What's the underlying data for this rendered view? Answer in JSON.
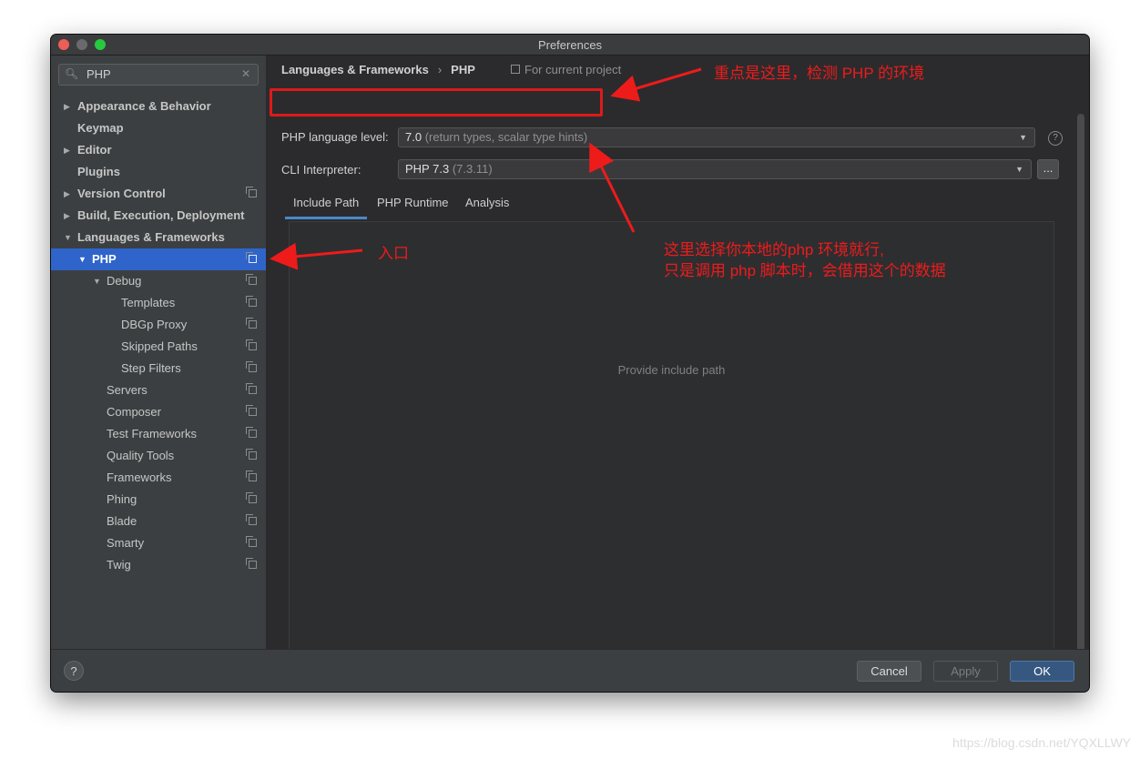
{
  "window": {
    "title": "Preferences"
  },
  "search": {
    "value": "PHP",
    "icon": "search-icon"
  },
  "sidebar": {
    "items": [
      {
        "label": "Appearance & Behavior",
        "arrow": "▶",
        "level": 0,
        "bold": true,
        "copy": false
      },
      {
        "label": "Keymap",
        "arrow": "",
        "level": 0,
        "bold": true,
        "copy": false
      },
      {
        "label": "Editor",
        "arrow": "▶",
        "level": 0,
        "bold": true,
        "copy": false
      },
      {
        "label": "Plugins",
        "arrow": "",
        "level": 0,
        "bold": true,
        "copy": false
      },
      {
        "label": "Version Control",
        "arrow": "▶",
        "level": 0,
        "bold": true,
        "copy": true
      },
      {
        "label": "Build, Execution, Deployment",
        "arrow": "▶",
        "level": 0,
        "bold": true,
        "copy": false
      },
      {
        "label": "Languages & Frameworks",
        "arrow": "▼",
        "level": 0,
        "bold": true,
        "copy": false
      },
      {
        "label": "PHP",
        "arrow": "▼",
        "level": 1,
        "bold": true,
        "copy": true,
        "selected": true
      },
      {
        "label": "Debug",
        "arrow": "▼",
        "level": 2,
        "bold": false,
        "copy": true
      },
      {
        "label": "Templates",
        "arrow": "",
        "level": 3,
        "bold": false,
        "copy": true
      },
      {
        "label": "DBGp Proxy",
        "arrow": "",
        "level": 3,
        "bold": false,
        "copy": true
      },
      {
        "label": "Skipped Paths",
        "arrow": "",
        "level": 3,
        "bold": false,
        "copy": true
      },
      {
        "label": "Step Filters",
        "arrow": "",
        "level": 3,
        "bold": false,
        "copy": true
      },
      {
        "label": "Servers",
        "arrow": "",
        "level": 2,
        "bold": false,
        "copy": true
      },
      {
        "label": "Composer",
        "arrow": "",
        "level": 2,
        "bold": false,
        "copy": true
      },
      {
        "label": "Test Frameworks",
        "arrow": "",
        "level": 2,
        "bold": false,
        "copy": true
      },
      {
        "label": "Quality Tools",
        "arrow": "",
        "level": 2,
        "bold": false,
        "copy": true
      },
      {
        "label": "Frameworks",
        "arrow": "",
        "level": 2,
        "bold": false,
        "copy": true
      },
      {
        "label": "Phing",
        "arrow": "",
        "level": 2,
        "bold": false,
        "copy": true
      },
      {
        "label": "Blade",
        "arrow": "",
        "level": 2,
        "bold": false,
        "copy": true
      },
      {
        "label": "Smarty",
        "arrow": "",
        "level": 2,
        "bold": false,
        "copy": true
      },
      {
        "label": "Twig",
        "arrow": "",
        "level": 2,
        "bold": false,
        "copy": true
      }
    ]
  },
  "breadcrumb": {
    "parent": "Languages & Frameworks",
    "separator": "›",
    "current": "PHP",
    "scope": "For current project"
  },
  "form": {
    "language_level_label": "PHP language level:",
    "language_level_value": "7.0",
    "language_level_hint": "(return types, scalar type hints)",
    "cli_label": "CLI Interpreter:",
    "cli_value": "PHP 7.3",
    "cli_hint": "(7.3.11)",
    "more_button": "...",
    "help": "?"
  },
  "tabs": [
    "Include Path",
    "PHP Runtime",
    "Analysis"
  ],
  "include_path": {
    "empty_text": "Provide include path",
    "toolbar": [
      "+",
      "−",
      "▲",
      "▼",
      "↓ª"
    ]
  },
  "footer": {
    "help": "?",
    "cancel": "Cancel",
    "apply": "Apply",
    "ok": "OK"
  },
  "annotations": {
    "top": "重点是这里，检测 PHP 的环境",
    "entry": "入口",
    "cli_line1": "这里选择你本地的php 环境就行,",
    "cli_line2": "只是调用 php 脚本时，会借用这个的数据"
  },
  "watermark": "https://blog.csdn.net/YQXLLWY",
  "colors": {
    "selection": "#2f65ca",
    "annotation": "#ee1b1b",
    "ok_button": "#365880"
  }
}
